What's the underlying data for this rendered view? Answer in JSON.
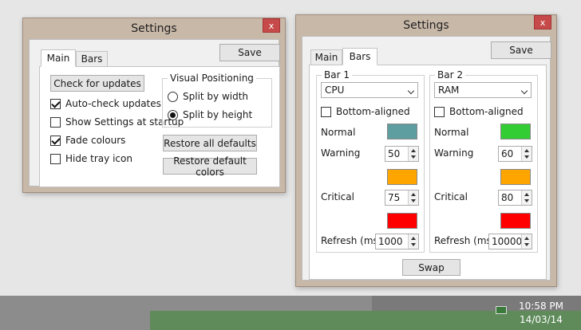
{
  "window1": {
    "title": "Settings",
    "close_label": "x",
    "save_label": "Save",
    "tabs": [
      {
        "label": "Main",
        "active": true
      },
      {
        "label": "Bars",
        "active": false
      }
    ],
    "check_updates_label": "Check for updates",
    "checkboxes": [
      {
        "label": "Auto-check updates",
        "checked": true
      },
      {
        "label": "Show Settings at startup",
        "checked": false
      },
      {
        "label": "Fade colours",
        "checked": true
      },
      {
        "label": "Hide tray icon",
        "checked": false
      }
    ],
    "visual_positioning": {
      "title": "Visual Positioning",
      "options": [
        {
          "label": "Split by width",
          "selected": false
        },
        {
          "label": "Split by height",
          "selected": true
        }
      ]
    },
    "restore_defaults_label": "Restore all defaults",
    "restore_colors_label": "Restore default colors"
  },
  "window2": {
    "title": "Settings",
    "close_label": "x",
    "save_label": "Save",
    "tabs": [
      {
        "label": "Main",
        "active": false
      },
      {
        "label": "Bars",
        "active": true
      }
    ],
    "bars": [
      {
        "title": "Bar 1",
        "source": "CPU",
        "bottom_aligned_label": "Bottom-aligned",
        "bottom_aligned": false,
        "normal_label": "Normal",
        "normal_color": "#5f9ea0",
        "warning_label": "Warning",
        "warning_value": "50",
        "warning_color": "#ffa500",
        "critical_label": "Critical",
        "critical_value": "75",
        "critical_color": "#ff0000",
        "refresh_label": "Refresh (ms)",
        "refresh_value": "1000"
      },
      {
        "title": "Bar 2",
        "source": "RAM",
        "bottom_aligned_label": "Bottom-aligned",
        "bottom_aligned": false,
        "normal_label": "Normal",
        "normal_color": "#32cd32",
        "warning_label": "Warning",
        "warning_value": "60",
        "warning_color": "#ffa500",
        "critical_label": "Critical",
        "critical_value": "80",
        "critical_color": "#ff0000",
        "refresh_label": "Refresh (ms)",
        "refresh_value": "10000"
      }
    ],
    "swap_label": "Swap"
  },
  "taskbar": {
    "time": "10:58 PM",
    "date": "14/03/14",
    "tray_icon": "battery-icon"
  }
}
